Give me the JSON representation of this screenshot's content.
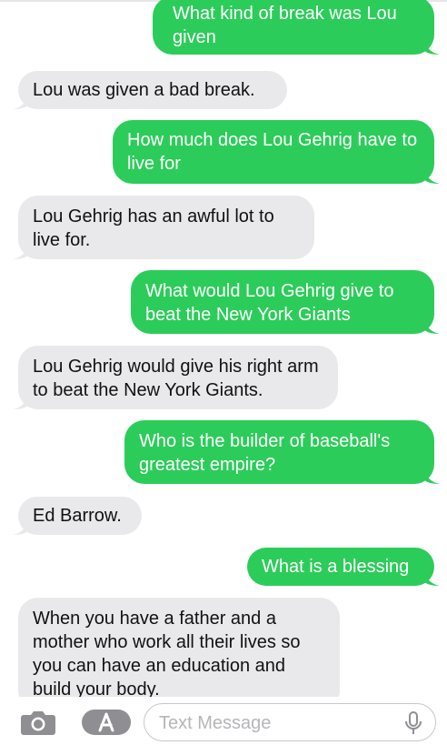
{
  "messages": [
    {
      "side": "out",
      "text": "What kind of break was Lou given"
    },
    {
      "side": "in",
      "text": "Lou was given a bad break."
    },
    {
      "side": "out",
      "text": "How much does Lou Gehrig have to live for"
    },
    {
      "side": "in",
      "text": "Lou Gehrig has an awful lot to live for."
    },
    {
      "side": "out",
      "text": "What would Lou Gehrig give to beat the New York Giants"
    },
    {
      "side": "in",
      "text": "Lou Gehrig would give his right arm to beat the New York Giants."
    },
    {
      "side": "out",
      "text": "Who is the builder of baseball's greatest empire?"
    },
    {
      "side": "in",
      "text": "Ed Barrow."
    },
    {
      "side": "out",
      "text": "What is a blessing"
    },
    {
      "side": "in",
      "text": "When you have a father and a mother who work all their lives so you can have an education and build your body."
    }
  ],
  "input_bar": {
    "placeholder": "Text Message",
    "camera_icon": "camera-icon",
    "apps_icon": "app-store-icon",
    "mic_icon": "microphone-icon"
  },
  "colors": {
    "outgoing_bubble": "#2ccc5a",
    "incoming_bubble": "#e9e9eb",
    "outgoing_text": "#ffffff",
    "incoming_text": "#111111"
  }
}
